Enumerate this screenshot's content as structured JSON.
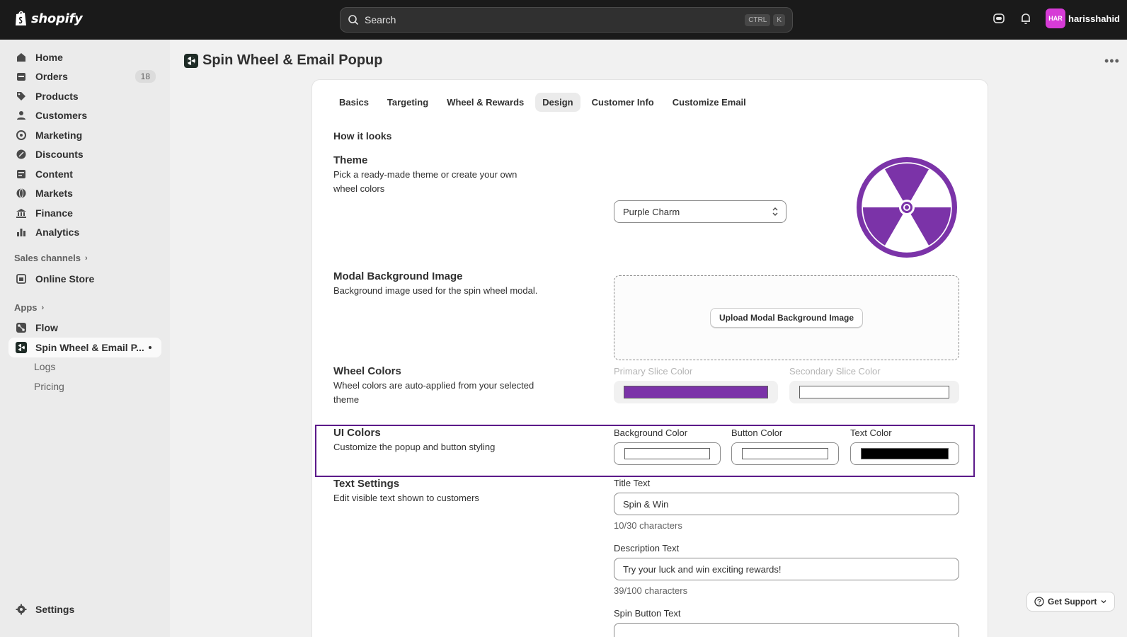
{
  "topbar": {
    "brand": "shopify",
    "search_placeholder": "Search",
    "shortcut_keys": [
      "CTRL",
      "K"
    ],
    "avatar_initials": "HAR",
    "username": "harisshahid"
  },
  "sidebar": {
    "items": [
      {
        "label": "Home",
        "icon": "home-icon"
      },
      {
        "label": "Orders",
        "icon": "orders-icon",
        "badge": "18"
      },
      {
        "label": "Products",
        "icon": "tag-icon"
      },
      {
        "label": "Customers",
        "icon": "person-icon"
      },
      {
        "label": "Marketing",
        "icon": "target-icon"
      },
      {
        "label": "Discounts",
        "icon": "discount-icon"
      },
      {
        "label": "Content",
        "icon": "content-icon"
      },
      {
        "label": "Markets",
        "icon": "globe-icon"
      },
      {
        "label": "Finance",
        "icon": "bank-icon"
      },
      {
        "label": "Analytics",
        "icon": "chart-bar-icon"
      }
    ],
    "sales_channels_label": "Sales channels",
    "online_store_label": "Online Store",
    "apps_label": "Apps",
    "flow_label": "Flow",
    "app_label": "Spin Wheel & Email P...",
    "app_sub_items": [
      "Logs",
      "Pricing"
    ],
    "settings_label": "Settings"
  },
  "page": {
    "title": "Spin Wheel & Email Popup",
    "more_label": "•••"
  },
  "tabs": [
    "Basics",
    "Targeting",
    "Wheel & Rewards",
    "Design",
    "Customer Info",
    "Customize Email"
  ],
  "active_tab": "Design",
  "design": {
    "section_heading": "How it looks",
    "theme": {
      "title": "Theme",
      "description": "Pick a ready-made theme or create your own wheel colors",
      "selected": "Purple Charm"
    },
    "modal_bg": {
      "title": "Modal Background Image",
      "description": "Background image used for the spin wheel modal.",
      "button": "Upload Modal Background Image"
    },
    "wheel_colors": {
      "title": "Wheel Colors",
      "description": "Wheel colors are auto-applied from your selected theme",
      "primary_label": "Primary Slice Color",
      "secondary_label": "Secondary Slice Color",
      "primary_color": "#7b33a8",
      "secondary_color": "#ffffff"
    },
    "ui_colors": {
      "title": "UI Colors",
      "description": "Customize the popup and button styling",
      "background_label": "Background Color",
      "button_label": "Button Color",
      "text_label": "Text Color",
      "background_color": "#ffffff",
      "button_color": "#ffffff",
      "text_color": "#000000"
    },
    "text_settings": {
      "title": "Text Settings",
      "description": "Edit visible text shown to customers",
      "title_label": "Title Text",
      "title_value": "Spin & Win",
      "title_count": "10/30 characters",
      "desc_label": "Description Text",
      "desc_value": "Try your luck and win exciting rewards!",
      "desc_count": "39/100 characters",
      "spin_label": "Spin Button Text"
    }
  },
  "support": {
    "label": "Get Support"
  },
  "colors": {
    "accent": "#7b33a8",
    "highlight_border": "#5c1a8a"
  }
}
